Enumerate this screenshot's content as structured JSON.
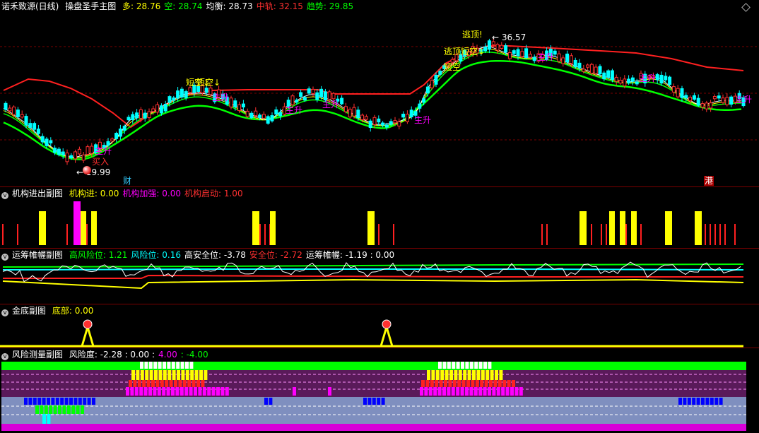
{
  "main": {
    "title": "诺禾致源(日线)",
    "indicator": "操盘圣手主图",
    "items": [
      {
        "label": "多:",
        "value": "28.76",
        "color": "#ffff00"
      },
      {
        "label": "空:",
        "value": "28.74",
        "color": "#00ff00"
      },
      {
        "label": "均衡:",
        "value": "28.73",
        "color": "#ffffff"
      },
      {
        "label": "中轨:",
        "value": "32.15",
        "color": "#ff3030"
      },
      {
        "label": "趋势:",
        "value": "29.85",
        "color": "#00ff00"
      }
    ],
    "annotations": {
      "high": "36.57",
      "low": "19.99",
      "escape_top": "逃顶!",
      "escape_top_short": "逃顶短空↓",
      "short_empty": "短空",
      "short_empty_2": "短空↓",
      "short_empty_3": "短空↓",
      "buy": "买入",
      "main_rise": "主升",
      "fin_marker": "财",
      "hk_marker": "港"
    },
    "chart_data": {
      "type": "candlestick",
      "series": [
        {
          "name": "多",
          "last": 28.76
        },
        {
          "name": "空",
          "last": 28.74
        },
        {
          "name": "均衡",
          "last": 28.73
        },
        {
          "name": "中轨",
          "last": 32.15
        },
        {
          "name": "趋势",
          "last": 29.85
        }
      ],
      "high": 36.57,
      "low": 19.99
    }
  },
  "sub1": {
    "title": "机构进出副图",
    "items": [
      {
        "label": "机构进:",
        "value": "0.00",
        "color": "#ffff00"
      },
      {
        "label": "机构加强:",
        "value": "0.00",
        "color": "#ff00ff"
      },
      {
        "label": "机构启动:",
        "value": "1.00",
        "color": "#ff3030"
      }
    ]
  },
  "sub2": {
    "title": "运筹帷幄副图",
    "items": [
      {
        "label": "高风险位:",
        "value": "1.21",
        "color": "#00ff00"
      },
      {
        "label": "风险位:",
        "value": "0.16",
        "color": "#00ffff"
      },
      {
        "label": "高安全位:",
        "value": "-3.78",
        "color": "#ffffff"
      },
      {
        "label": "安全位:",
        "value": "-2.72",
        "color": "#ff3030"
      },
      {
        "label": "运筹帷幄:",
        "value": "-1.19 : 0.00",
        "color": "#ffffff"
      }
    ]
  },
  "sub3": {
    "title": "金底副图",
    "items": [
      {
        "label": "底部:",
        "value": "0.00",
        "color": "#ffff00"
      }
    ]
  },
  "sub4": {
    "title": "风险测量副图",
    "items": [
      {
        "label": "风险度:",
        "value": "-2.28 : 0.00 :",
        "color": "#ffffff"
      },
      {
        "label": "",
        "value": "4.00",
        "color": "#ff00ff"
      },
      {
        "label": "",
        "value": ": -4.00",
        "color": "#00ff00"
      }
    ]
  },
  "colors": {
    "up": "#ff3030",
    "down": "#00ffff",
    "separator": "#7a0000",
    "background": "#000000"
  }
}
